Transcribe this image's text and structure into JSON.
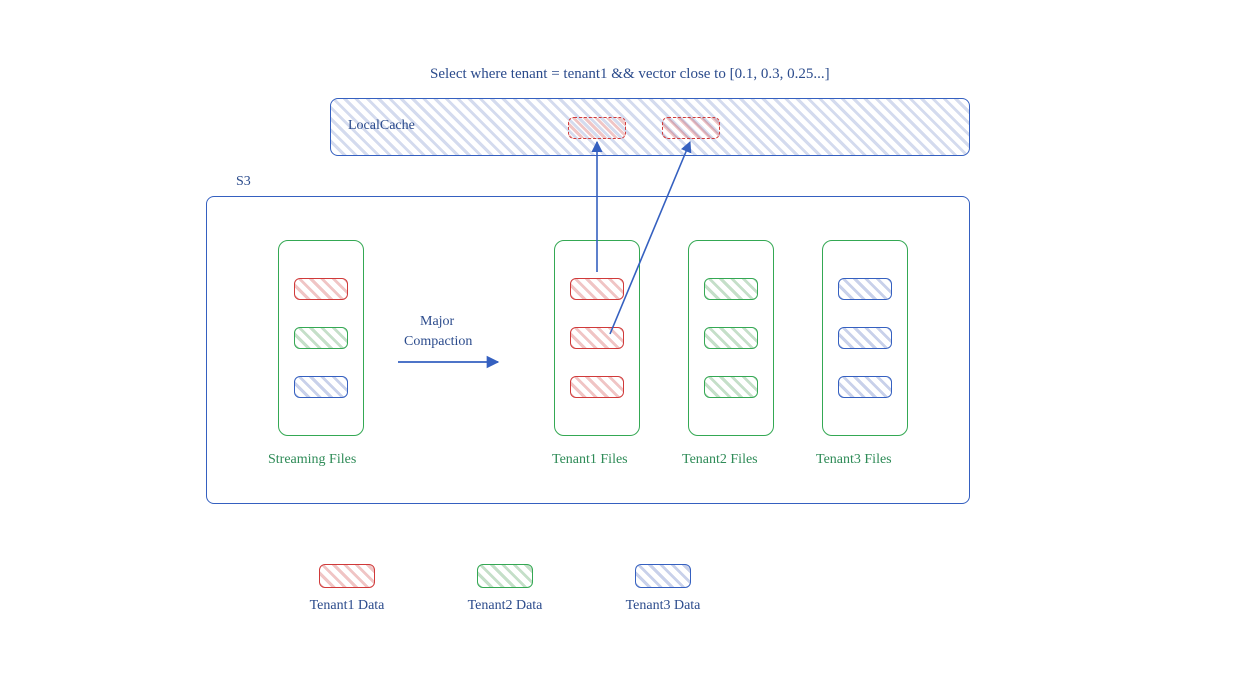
{
  "query_text": "Select where tenant = tenant1 && vector close to [0.1, 0.3, 0.25...]",
  "cache": {
    "label": "LocalCache"
  },
  "s3": {
    "label": "S3"
  },
  "compaction": {
    "line1": "Major",
    "line2": "Compaction"
  },
  "columns": {
    "streaming": {
      "label": "Streaming Files"
    },
    "t1": {
      "label": "Tenant1 Files"
    },
    "t2": {
      "label": "Tenant2 Files"
    },
    "t3": {
      "label": "Tenant3 Files"
    }
  },
  "legend": {
    "t1": "Tenant1 Data",
    "t2": "Tenant2 Data",
    "t3": "Tenant3 Data"
  },
  "colors": {
    "blue": "#3560c0",
    "green": "#34a853",
    "red": "#d03a3a"
  }
}
